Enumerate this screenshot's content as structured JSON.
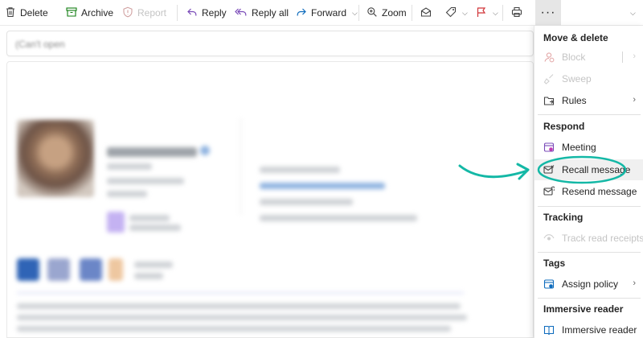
{
  "toolbar": {
    "delete_label": "Delete",
    "archive_label": "Archive",
    "report_label": "Report",
    "reply_label": "Reply",
    "reply_all_label": "Reply all",
    "forward_label": "Forward",
    "zoom_label": "Zoom",
    "more_label": "···"
  },
  "email": {
    "subject_placeholder": "(Can't open"
  },
  "menu": {
    "sections": [
      {
        "heading": "Move & delete",
        "items": [
          {
            "label": "Block",
            "icon": "block-icon",
            "enabled": false,
            "submenu": true
          },
          {
            "label": "Sweep",
            "icon": "sweep-icon",
            "enabled": false
          },
          {
            "label": "Rules",
            "icon": "rules-icon",
            "enabled": true,
            "submenu": true
          }
        ]
      },
      {
        "heading": "Respond",
        "items": [
          {
            "label": "Meeting",
            "icon": "meeting-icon",
            "enabled": true
          },
          {
            "label": "Recall message",
            "icon": "recall-icon",
            "enabled": true,
            "highlighted": true
          },
          {
            "label": "Resend message",
            "icon": "resend-icon",
            "enabled": true
          }
        ]
      },
      {
        "heading": "Tracking",
        "items": [
          {
            "label": "Track read receipts",
            "icon": "eye-icon",
            "enabled": false
          }
        ]
      },
      {
        "heading": "Tags",
        "items": [
          {
            "label": "Assign policy",
            "icon": "policy-icon",
            "enabled": true,
            "submenu": true
          }
        ]
      },
      {
        "heading": "Immersive reader",
        "items": [
          {
            "label": "Immersive reader",
            "icon": "immersive-reader-icon",
            "enabled": true
          }
        ]
      }
    ]
  },
  "colors": {
    "accent": "#0f6cbd",
    "annotation": "#14b8a6",
    "flag": "#d13438",
    "disabled_text": "#c4c4c4"
  }
}
